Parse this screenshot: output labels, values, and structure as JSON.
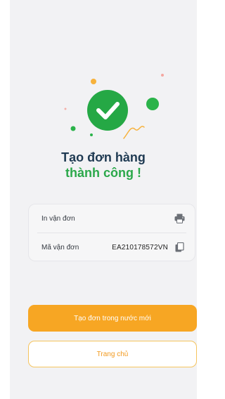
{
  "success": {
    "title_line1": "Tạo đơn hàng",
    "title_line2": "thành công !",
    "icon": "check-circle-icon"
  },
  "order_info": {
    "print_label": "In vận đơn",
    "print_icon": "printer-icon",
    "tracking_label": "Mã vận đơn",
    "tracking_value": "EA210178572VN",
    "copy_icon": "copy-icon"
  },
  "actions": {
    "create_new_label": "Tạo đơn trong nước mới",
    "home_label": "Trang chủ"
  },
  "colors": {
    "accent_green": "#2ba84a",
    "primary_orange": "#f7a623",
    "title_navy": "#1f3a52"
  }
}
